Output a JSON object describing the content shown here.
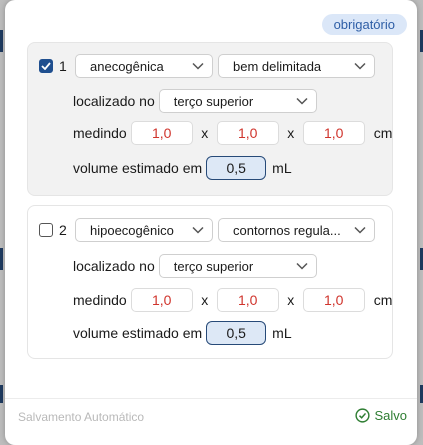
{
  "badge": "obrigatório",
  "findings": [
    {
      "checked": true,
      "index": "1",
      "echogenicity": "anecogênica",
      "margins": "bem delimitada",
      "location_label": "localizado no",
      "location": "terço superior",
      "measure_label": "medindo",
      "dim1": "1,0",
      "times1": "x",
      "dim2": "1,0",
      "times2": "x",
      "dim3": "1,0",
      "unit": "cm",
      "volume_label": "volume estimado em",
      "volume": "0,5",
      "volume_unit": "mL"
    },
    {
      "checked": false,
      "index": "2",
      "echogenicity": "hipoecogênico",
      "margins": "contornos regula...",
      "location_label": "localizado no",
      "location": "terço superior",
      "measure_label": "medindo",
      "dim1": "1,0",
      "times1": "x",
      "dim2": "1,0",
      "times2": "x",
      "dim3": "1,0",
      "unit": "cm",
      "volume_label": "volume estimado em",
      "volume": "0,5",
      "volume_unit": "mL"
    }
  ],
  "footer": {
    "autosave": "Salvamento Automático",
    "saved": "Salvo"
  },
  "colors": {
    "accent": "#1f4f8f",
    "value_red": "#d0342c",
    "saved_green": "#2e7d32",
    "badge_bg": "#dbe7f8"
  },
  "icons": [
    "checkbox-checked-icon",
    "checkbox-empty-icon",
    "chevron-down-icon",
    "check-circle-icon"
  ]
}
